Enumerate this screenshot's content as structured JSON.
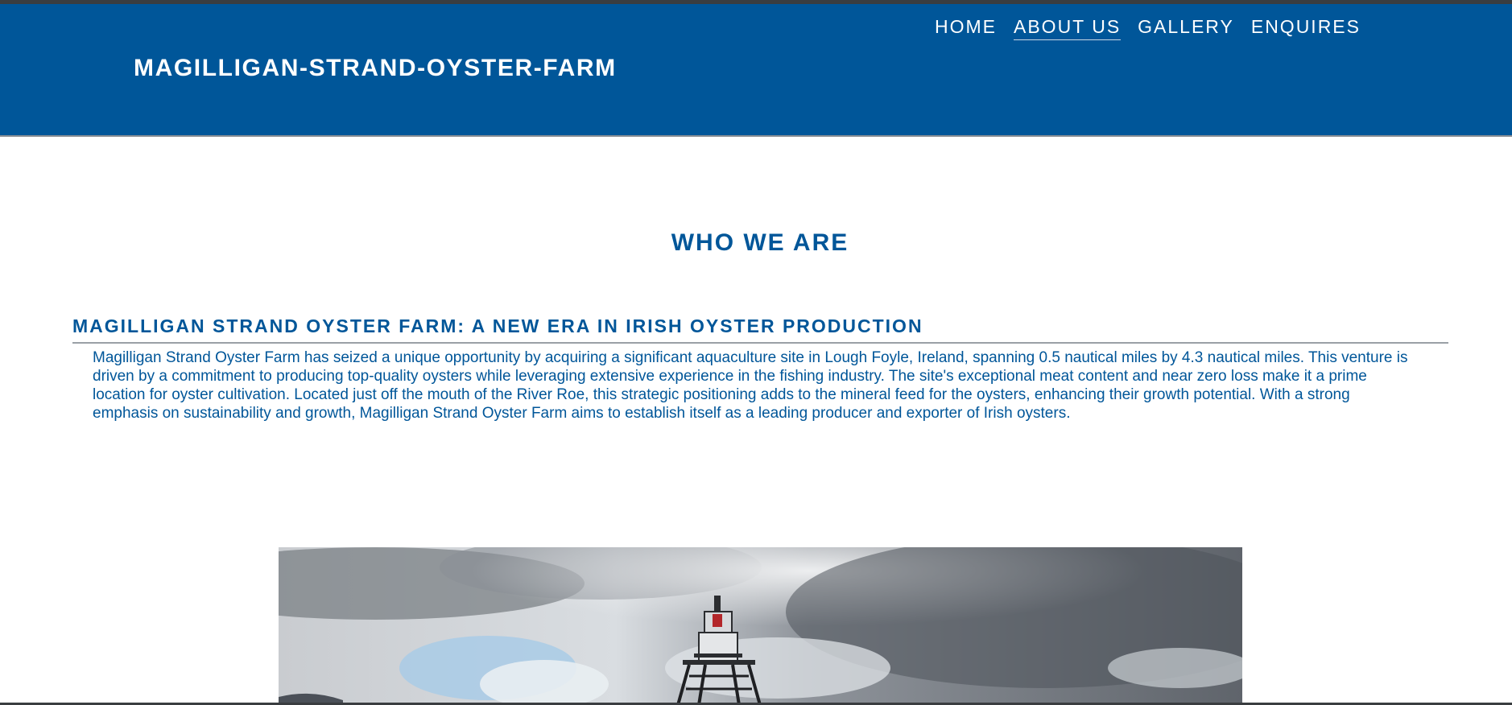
{
  "site": {
    "title": "MAGILLIGAN-STRAND-OYSTER-FARM"
  },
  "nav": {
    "items": [
      {
        "label": "HOME"
      },
      {
        "label": "ABOUT US",
        "active": true
      },
      {
        "label": "GALLERY"
      },
      {
        "label": "ENQUIRES"
      }
    ]
  },
  "main": {
    "section_title": "WHO WE ARE",
    "subheading": "MAGILLIGAN STRAND OYSTER FARM: A NEW ERA IN IRISH OYSTER PRODUCTION",
    "paragraph": "Magilligan Strand Oyster Farm has seized a unique opportunity by acquiring a significant aquaculture site in Lough Foyle, Ireland, spanning 0.5 nautical miles by 4.3 nautical miles. This venture is driven by a commitment to producing top-quality oysters while leveraging extensive experience in the fishing industry. The site's exceptional meat content and near zero loss make it a prime location for oyster cultivation. Located just off the mouth of the River Roe, this strategic positioning adds to the mineral feed for the oysters, enhancing their growth potential. With a strong emphasis on sustainability and growth, Magilligan Strand Oyster Farm aims to establish itself as a leading producer and exporter of Irish oysters."
  },
  "colors": {
    "brand_blue": "#005699",
    "header_text": "#ffffff",
    "frame_dark": "#3a3d40"
  }
}
